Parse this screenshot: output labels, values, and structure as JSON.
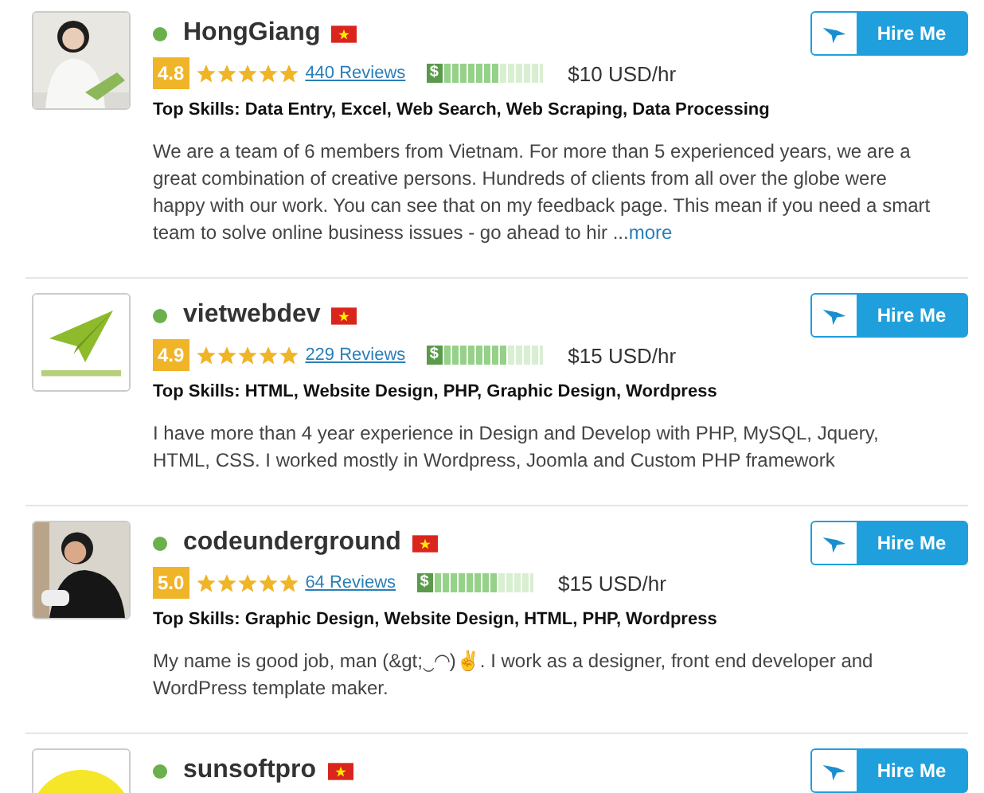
{
  "freelancers": [
    {
      "online": true,
      "name": "HongGiang",
      "rating": "4.8",
      "stars": 5,
      "reviews": "440 Reviews",
      "price_symbol": "$",
      "level": 0.55,
      "rate": "$10 USD/hr",
      "skills": "Top Skills: Data Entry, Excel, Web Search, Web Scraping, Data Processing",
      "description": "We are a team of 6 members from Vietnam. For more than 5 experienced years, we are a great combination of creative persons. Hundreds of clients from all over the globe were happy with our work. You can see that on my feedback page. This mean if you need a smart team to solve online business issues - go ahead to hir ...",
      "more": "more",
      "button": "Hire Me"
    },
    {
      "online": true,
      "name": "vietwebdev",
      "rating": "4.9",
      "stars": 5,
      "reviews": "229 Reviews",
      "price_symbol": "$",
      "level": 0.65,
      "rate": "$15 USD/hr",
      "skills": "Top Skills: HTML, Website Design, PHP, Graphic Design, Wordpress",
      "description": "I have more than 4 year experience in Design and Develop with PHP, MySQL, Jquery, HTML, CSS. I worked mostly in Wordpress, Joomla and Custom PHP framework",
      "button": "Hire Me"
    },
    {
      "online": true,
      "name": "codeunderground",
      "rating": "5.0",
      "stars": 5,
      "reviews": "64 Reviews",
      "price_symbol": "$",
      "level": 0.65,
      "rate": "$15 USD/hr",
      "skills": "Top Skills: Graphic Design, Website Design, HTML, PHP, Wordpress",
      "description": "My name is good job, man (&gt;‿◠)✌. I work as a designer, front end developer and WordPress template maker.",
      "button": "Hire Me"
    },
    {
      "online": true,
      "name": "sunsoftpro",
      "button": "Hire Me"
    }
  ]
}
